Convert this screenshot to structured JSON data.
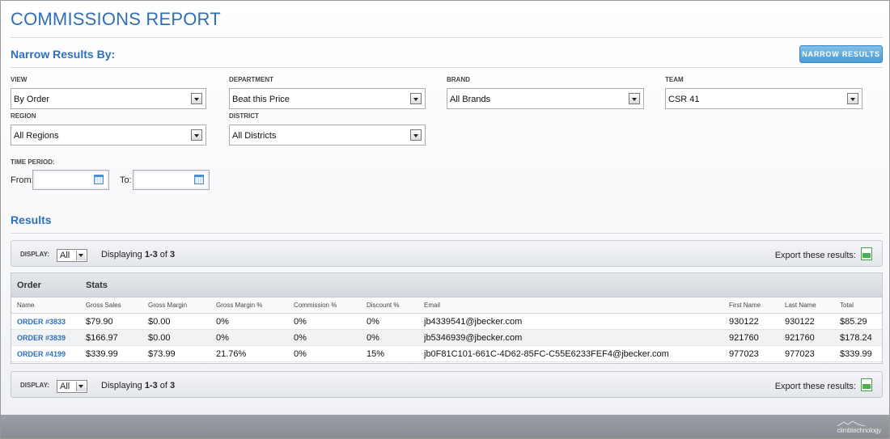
{
  "header": {
    "title": "COMMISSIONS REPORT"
  },
  "filters": {
    "section_title": "Narrow Results By:",
    "narrow_button": "NARROW RESULTS",
    "view": {
      "label": "VIEW",
      "value": "By Order"
    },
    "department": {
      "label": "DEPARTMENT",
      "value": "Beat this Price"
    },
    "brand": {
      "label": "BRAND",
      "value": "All Brands"
    },
    "team": {
      "label": "TEAM",
      "value": "CSR 41"
    },
    "region": {
      "label": "REGION",
      "value": "All Regions"
    },
    "district": {
      "label": "DISTRICT",
      "value": "All Districts"
    },
    "time_period": {
      "label": "TIME PERIOD:",
      "from_label": "From:",
      "to_label": "To:",
      "from_value": "",
      "to_value": ""
    }
  },
  "results": {
    "section_title": "Results",
    "toolbar": {
      "display_label": "DISPLAY:",
      "display_value": "All",
      "count_prefix": "Displaying ",
      "count_range": "1-3",
      "count_mid": " of ",
      "count_total": "3",
      "export_label": "Export these results:",
      "export_icon": "xls-icon"
    },
    "group_headers": [
      "Order",
      "Stats"
    ],
    "columns": [
      "Name",
      "Gross Sales",
      "Gross Margin",
      "Gross Margin %",
      "Commission %",
      "Discount %",
      "Email",
      "First Name",
      "Last Name",
      "Total"
    ],
    "rows": [
      [
        "ORDER #3833",
        "$79.90",
        "$0.00",
        "0%",
        "0%",
        "0%",
        "jb4339541@jbecker.com",
        "930122",
        "930122",
        "$85.29"
      ],
      [
        "ORDER #3839",
        "$166.97",
        "$0.00",
        "0%",
        "0%",
        "0%",
        "jb5346939@jbecker.com",
        "921760",
        "921760",
        "$178.24"
      ],
      [
        "ORDER #4199",
        "$339.99",
        "$73.99",
        "21.76%",
        "0%",
        "15%",
        "jb0F81C101-661C-4D62-85FC-C55E6233FEF4@jbecker.com",
        "977023",
        "977023",
        "$339.99"
      ]
    ]
  },
  "footer": {
    "logo_text": "climbtechnology"
  }
}
